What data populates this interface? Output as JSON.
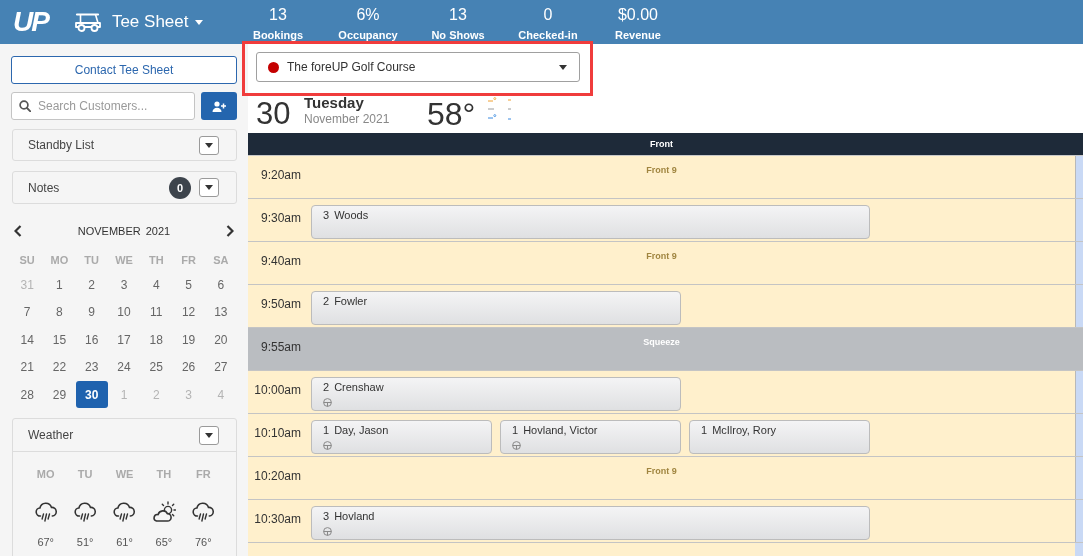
{
  "top_bar": {
    "logo": "UP",
    "module": "Tee Sheet",
    "stats": [
      {
        "value": "13",
        "label": "Bookings"
      },
      {
        "value": "6%",
        "label": "Occupancy"
      },
      {
        "value": "13",
        "label": "No Shows"
      },
      {
        "value": "0",
        "label": "Checked-in"
      },
      {
        "value": "$0.00",
        "label": "Revenue"
      }
    ]
  },
  "sidebar": {
    "contact_button": "Contact Tee Sheet",
    "search": {
      "placeholder": "Search Customers..."
    },
    "panels": [
      {
        "title": "Standby List"
      },
      {
        "title": "Notes",
        "count": "0"
      }
    ],
    "calendar": {
      "month": "NOVEMBER",
      "year": "2021",
      "weekdays": [
        "SU",
        "MO",
        "TU",
        "WE",
        "TH",
        "FR",
        "SA"
      ],
      "weeks": [
        [
          {
            "day": "31",
            "other_month": true,
            "selected": false
          },
          {
            "day": "1",
            "other_month": false,
            "selected": false
          },
          {
            "day": "2",
            "other_month": false,
            "selected": false
          },
          {
            "day": "3",
            "other_month": false,
            "selected": false
          },
          {
            "day": "4",
            "other_month": false,
            "selected": false
          },
          {
            "day": "5",
            "other_month": false,
            "selected": false
          },
          {
            "day": "6",
            "other_month": false,
            "selected": false
          }
        ],
        [
          {
            "day": "7",
            "other_month": false,
            "selected": false
          },
          {
            "day": "8",
            "other_month": false,
            "selected": false
          },
          {
            "day": "9",
            "other_month": false,
            "selected": false
          },
          {
            "day": "10",
            "other_month": false,
            "selected": false
          },
          {
            "day": "11",
            "other_month": false,
            "selected": false
          },
          {
            "day": "12",
            "other_month": false,
            "selected": false
          },
          {
            "day": "13",
            "other_month": false,
            "selected": false
          }
        ],
        [
          {
            "day": "14",
            "other_month": false,
            "selected": false
          },
          {
            "day": "15",
            "other_month": false,
            "selected": false
          },
          {
            "day": "16",
            "other_month": false,
            "selected": false
          },
          {
            "day": "17",
            "other_month": false,
            "selected": false
          },
          {
            "day": "18",
            "other_month": false,
            "selected": false
          },
          {
            "day": "19",
            "other_month": false,
            "selected": false
          },
          {
            "day": "20",
            "other_month": false,
            "selected": false
          }
        ],
        [
          {
            "day": "21",
            "other_month": false,
            "selected": false
          },
          {
            "day": "22",
            "other_month": false,
            "selected": false
          },
          {
            "day": "23",
            "other_month": false,
            "selected": false
          },
          {
            "day": "24",
            "other_month": false,
            "selected": false
          },
          {
            "day": "25",
            "other_month": false,
            "selected": false
          },
          {
            "day": "26",
            "other_month": false,
            "selected": false
          },
          {
            "day": "27",
            "other_month": false,
            "selected": false
          }
        ],
        [
          {
            "day": "28",
            "other_month": false,
            "selected": false
          },
          {
            "day": "29",
            "other_month": false,
            "selected": false
          },
          {
            "day": "30",
            "other_month": false,
            "selected": true
          },
          {
            "day": "1",
            "other_month": true,
            "selected": false
          },
          {
            "day": "2",
            "other_month": true,
            "selected": false
          },
          {
            "day": "3",
            "other_month": true,
            "selected": false
          },
          {
            "day": "4",
            "other_month": true,
            "selected": false
          }
        ]
      ]
    },
    "weather": {
      "title": "Weather",
      "days": [
        {
          "day": "MO",
          "kind": "rain",
          "temp": "67°"
        },
        {
          "day": "TU",
          "kind": "rain",
          "temp": "51°"
        },
        {
          "day": "WE",
          "kind": "rain",
          "temp": "61°"
        },
        {
          "day": "TH",
          "kind": "partly_sunny",
          "temp": "65°"
        },
        {
          "day": "FR",
          "kind": "rain",
          "temp": "76°"
        }
      ]
    }
  },
  "main": {
    "course_select": {
      "label": "The foreUP Golf Course",
      "highlighted": true
    },
    "date": {
      "day": "30",
      "weekday": "Tuesday",
      "month_year": "November 2021",
      "temperature": "58°"
    },
    "tee_sheet": {
      "column": "Front",
      "rows": [
        {
          "time": "9:20am",
          "kind": "slot",
          "label": "Front 9"
        },
        {
          "time": "9:30am",
          "kind": "slot",
          "bookings": [
            {
              "count": "3",
              "name": "Woods",
              "cart": false
            }
          ]
        },
        {
          "time": "9:40am",
          "kind": "slot",
          "label": "Front 9"
        },
        {
          "time": "9:50am",
          "kind": "slot",
          "bookings": [
            {
              "count": "2",
              "name": "Fowler",
              "cart": false
            }
          ]
        },
        {
          "time": "9:55am",
          "kind": "squeeze",
          "label": "Squeeze"
        },
        {
          "time": "10:00am",
          "kind": "slot",
          "bookings": [
            {
              "count": "2",
              "name": "Crenshaw",
              "cart": true
            }
          ]
        },
        {
          "time": "10:10am",
          "kind": "slot",
          "bookings": [
            {
              "count": "1",
              "name": "Day, Jason",
              "cart": true
            },
            {
              "count": "1",
              "name": "Hovland, Victor",
              "cart": true
            },
            {
              "count": "1",
              "name": "McIlroy, Rory",
              "cart": false
            }
          ]
        },
        {
          "time": "10:20am",
          "kind": "slot",
          "label": "Front 9"
        },
        {
          "time": "10:30am",
          "kind": "slot",
          "bookings": [
            {
              "count": "3",
              "name": "Hovland",
              "cart": true
            }
          ]
        }
      ]
    }
  }
}
